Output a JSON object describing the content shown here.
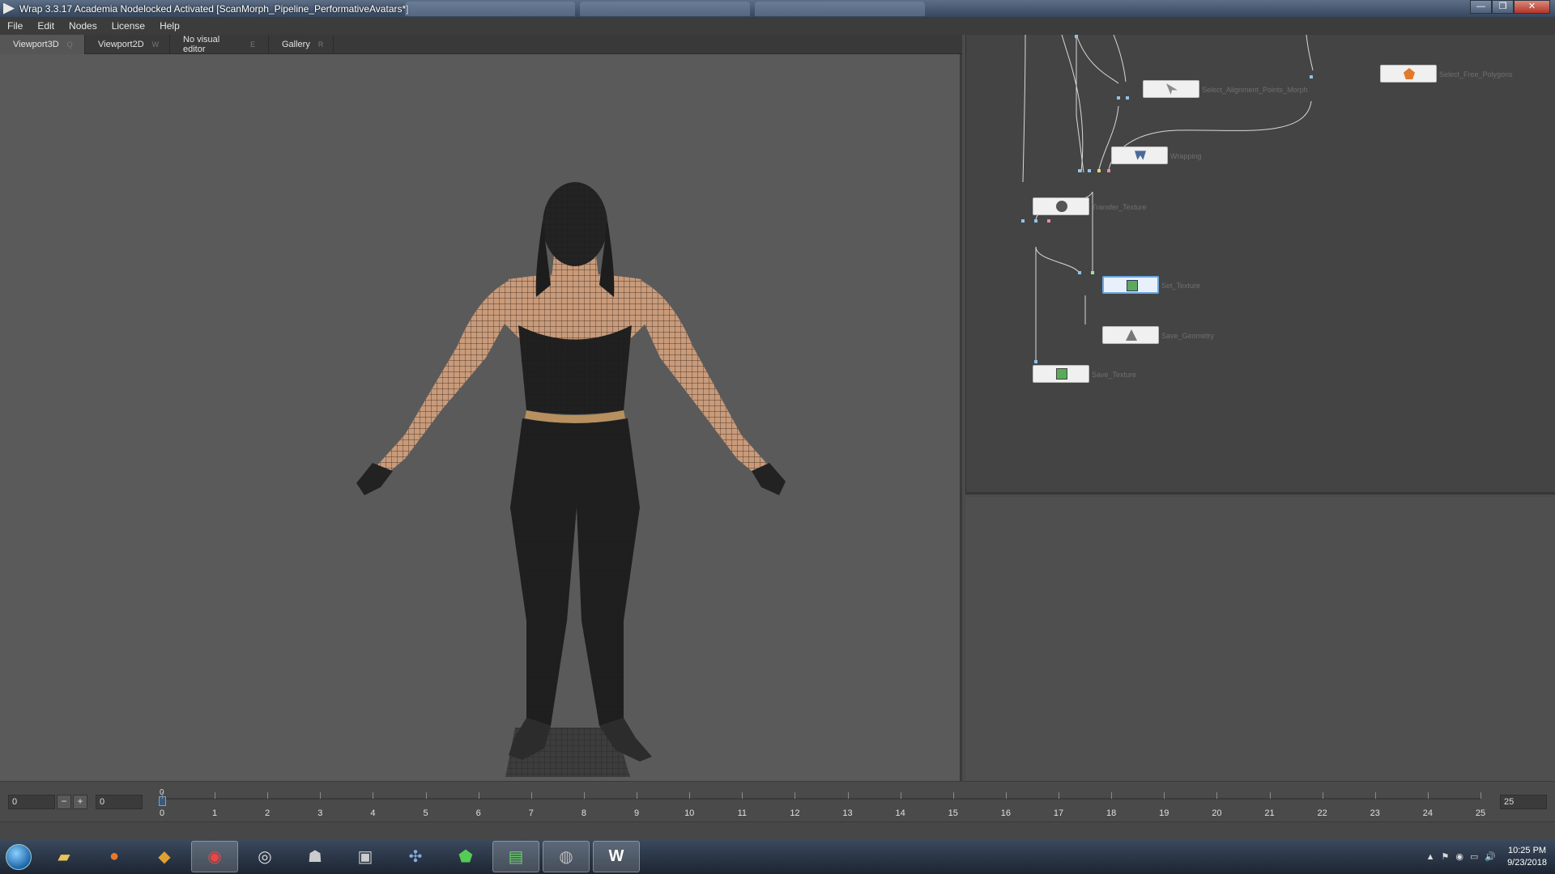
{
  "window": {
    "title": "Wrap 3.3.17 Academia Nodelocked Activated [ScanMorph_Pipeline_PerformativeAvatars*]",
    "controls": [
      "—",
      "❐",
      "✕"
    ]
  },
  "menu": [
    "File",
    "Edit",
    "Nodes",
    "License",
    "Help"
  ],
  "tabs": [
    {
      "label": "Viewport3D",
      "shortcut": "Q"
    },
    {
      "label": "Viewport2D",
      "shortcut": "W"
    },
    {
      "label": "No visual editor",
      "shortcut": "E"
    },
    {
      "label": "Gallery",
      "shortcut": "R"
    }
  ],
  "nodes": [
    {
      "label": "Select_Alignment_Points_Morph"
    },
    {
      "label": "Select_Free_Polygons"
    },
    {
      "label": "Wrapping"
    },
    {
      "label": "Transfer_Texture"
    },
    {
      "label": "Set_Texture"
    },
    {
      "label": "Save_Geometry"
    },
    {
      "label": "Save_Texture"
    }
  ],
  "timeline": {
    "start_value": "0",
    "current_value": "0",
    "end_value": "25",
    "playhead_label": "0",
    "ticks": [
      "0",
      "1",
      "2",
      "3",
      "4",
      "5",
      "6",
      "7",
      "8",
      "9",
      "10",
      "11",
      "12",
      "13",
      "14",
      "15",
      "16",
      "17",
      "18",
      "19",
      "20",
      "21",
      "22",
      "23",
      "24",
      "25"
    ],
    "minus": "−",
    "plus": "+"
  },
  "taskbar": {
    "apps": [
      "file-explorer",
      "firefox",
      "git",
      "chrome",
      "obs",
      "gitkraken",
      "vr-headset",
      "pinwheel",
      "polygon-app",
      "terminal",
      "disc",
      "wrap3"
    ],
    "time": "10:25 PM",
    "date": "9/23/2018",
    "tray_icons": [
      "▲",
      "⚑",
      "◉",
      "▭",
      "🔊"
    ]
  },
  "colors": {
    "title_bar": "#36465e",
    "viewport_bg": "#5a5a5a",
    "node_editor_bg": "#444444",
    "selection": "#6aa6e0"
  }
}
